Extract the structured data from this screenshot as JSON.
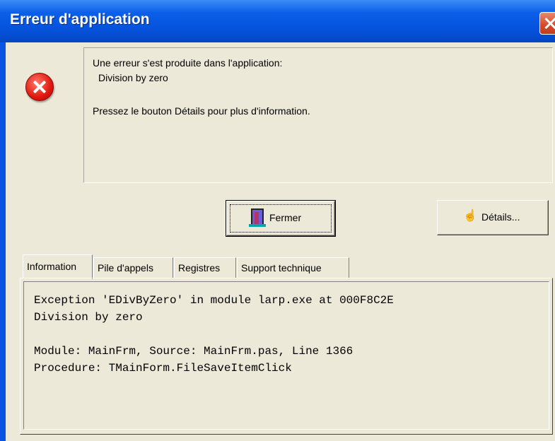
{
  "window": {
    "title": "Erreur d'application"
  },
  "icons": {
    "title_close": "close-icon",
    "error": "error-icon",
    "fermer": "door-exit-icon",
    "details": "hand-pointer-icon"
  },
  "message": {
    "line1": "Une erreur s'est produite dans l'application:",
    "line2": "Division by zero",
    "line3": "Pressez le bouton Détails pour plus d'information."
  },
  "buttons": {
    "fermer": "Fermer",
    "details": "Détails..."
  },
  "tabs": [
    {
      "label": "Information",
      "active": true
    },
    {
      "label": "Pile d'appels",
      "active": false
    },
    {
      "label": "Registres",
      "active": false
    },
    {
      "label": "Support technique",
      "active": false
    }
  ],
  "details": {
    "line1": "Exception 'EDivByZero' in module larp.exe at 000F8C2E",
    "line2": "Division by zero",
    "line3": "Module: MainFrm, Source: MainFrm.pas, Line 1366",
    "line4": "Procedure: TMainForm.FileSaveItemClick"
  },
  "colors": {
    "titlebar": "#0552dc",
    "dialog_bg": "#ece9d8",
    "close": "#d54a2a",
    "error": "#e0180f"
  }
}
